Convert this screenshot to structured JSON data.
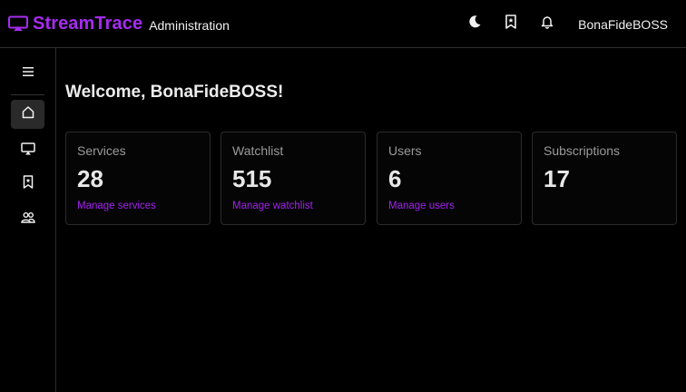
{
  "header": {
    "brand_name": "StreamTrace",
    "brand_sub": "Administration",
    "user_name": "BonaFideBOSS",
    "icons": [
      "theme-moon-icon",
      "bookmark-icon",
      "bell-icon"
    ]
  },
  "sidebar": {
    "items": [
      {
        "icon": "menu-icon"
      },
      {
        "icon": "home-icon",
        "active": true
      },
      {
        "icon": "tv-icon"
      },
      {
        "icon": "bookmark-icon"
      },
      {
        "icon": "users-icon"
      }
    ]
  },
  "main": {
    "welcome": "Welcome, BonaFideBOSS!",
    "cards": [
      {
        "title": "Services",
        "count": "28",
        "link": "Manage services"
      },
      {
        "title": "Watchlist",
        "count": "515",
        "link": "Manage watchlist"
      },
      {
        "title": "Users",
        "count": "6",
        "link": "Manage users"
      },
      {
        "title": "Subscriptions",
        "count": "17",
        "link": ""
      }
    ]
  },
  "colors": {
    "accent": "#a62cf0",
    "background": "#000000",
    "border": "#2e2e2e"
  }
}
